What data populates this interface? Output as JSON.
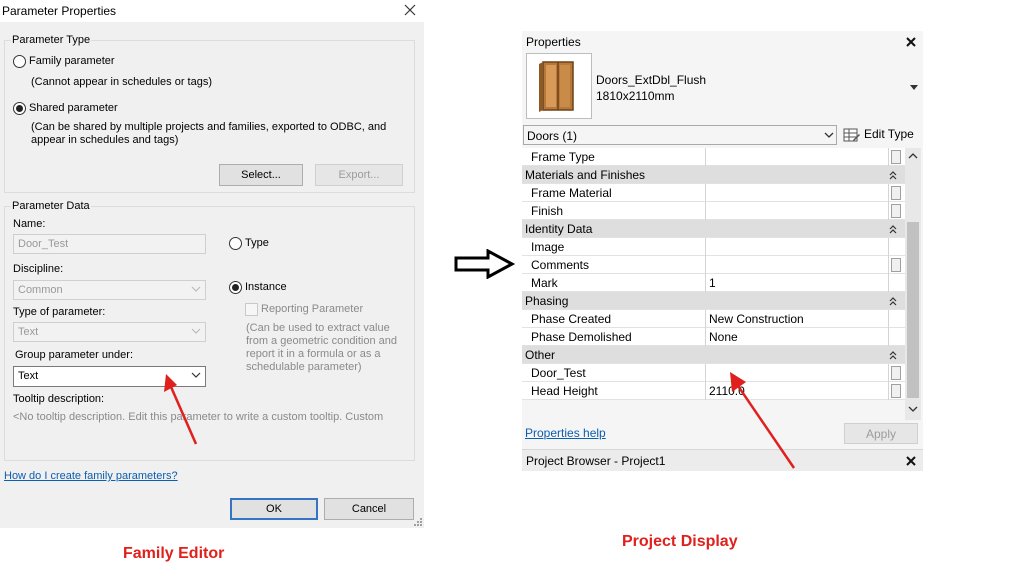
{
  "dialog": {
    "title": "Parameter Properties",
    "parameter_type": {
      "legend": "Parameter Type",
      "family_label": "Family parameter",
      "family_note": "(Cannot appear in schedules or tags)",
      "shared_label": "Shared parameter",
      "shared_note_line1": "(Can be shared by multiple projects and families, exported to ODBC, and",
      "shared_note_line2": "appear in schedules and tags)",
      "selected": "shared",
      "select_button": "Select...",
      "export_button": "Export..."
    },
    "parameter_data": {
      "legend": "Parameter Data",
      "name_label": "Name:",
      "name_value": "Door_Test",
      "discipline_label": "Discipline:",
      "discipline_value": "Common",
      "type_of_parameter_label": "Type of parameter:",
      "type_of_parameter_value": "Text",
      "group_label": "Group parameter under:",
      "group_value": "Text",
      "tooltip_label": "Tooltip description:",
      "tooltip_value": "<No tooltip description. Edit this parameter to write a custom tooltip. Custom",
      "type_radio": "Type",
      "instance_radio": "Instance",
      "instance_selected": true,
      "reporting_label": "Reporting Parameter",
      "reporting_note": [
        "(Can be used to extract value",
        "from a geometric condition and",
        "report it in a formula or as a",
        "schedulable parameter)"
      ]
    },
    "help_link": "How do I create family parameters?",
    "ok_button": "OK",
    "cancel_button": "Cancel"
  },
  "properties_panel": {
    "title": "Properties",
    "type_name": "Doors_ExtDbl_Flush",
    "type_size": "1810x2110mm",
    "selector": "Doors (1)",
    "edit_type": "Edit Type",
    "rows": [
      {
        "kind": "param",
        "label": "Frame Type",
        "value": "",
        "has_button": true
      },
      {
        "kind": "section",
        "label": "Materials and Finishes"
      },
      {
        "kind": "param",
        "label": "Frame Material",
        "value": "",
        "has_button": true
      },
      {
        "kind": "param",
        "label": "Finish",
        "value": "",
        "has_button": true
      },
      {
        "kind": "section",
        "label": "Identity Data"
      },
      {
        "kind": "param",
        "label": "Image",
        "value": "",
        "has_button": false
      },
      {
        "kind": "param",
        "label": "Comments",
        "value": "",
        "has_button": true
      },
      {
        "kind": "param",
        "label": "Mark",
        "value": "1",
        "has_button": false
      },
      {
        "kind": "section",
        "label": "Phasing"
      },
      {
        "kind": "param",
        "label": "Phase Created",
        "value": "New Construction",
        "has_button": false
      },
      {
        "kind": "param",
        "label": "Phase Demolished",
        "value": "None",
        "has_button": false
      },
      {
        "kind": "section",
        "label": "Other"
      },
      {
        "kind": "param",
        "label": "Door_Test",
        "value": "",
        "has_button": true
      },
      {
        "kind": "param",
        "label": "Head Height",
        "value": "2110.0",
        "has_button": true
      }
    ],
    "help_link": "Properties help",
    "apply_button": "Apply",
    "browser_title": "Project Browser - Project1"
  },
  "captions": {
    "left": "Family Editor",
    "right": "Project Display"
  },
  "colors": {
    "annotation_red": "#e0201c",
    "link_blue": "#0b5eb0",
    "default_button_border": "#3574c4"
  }
}
